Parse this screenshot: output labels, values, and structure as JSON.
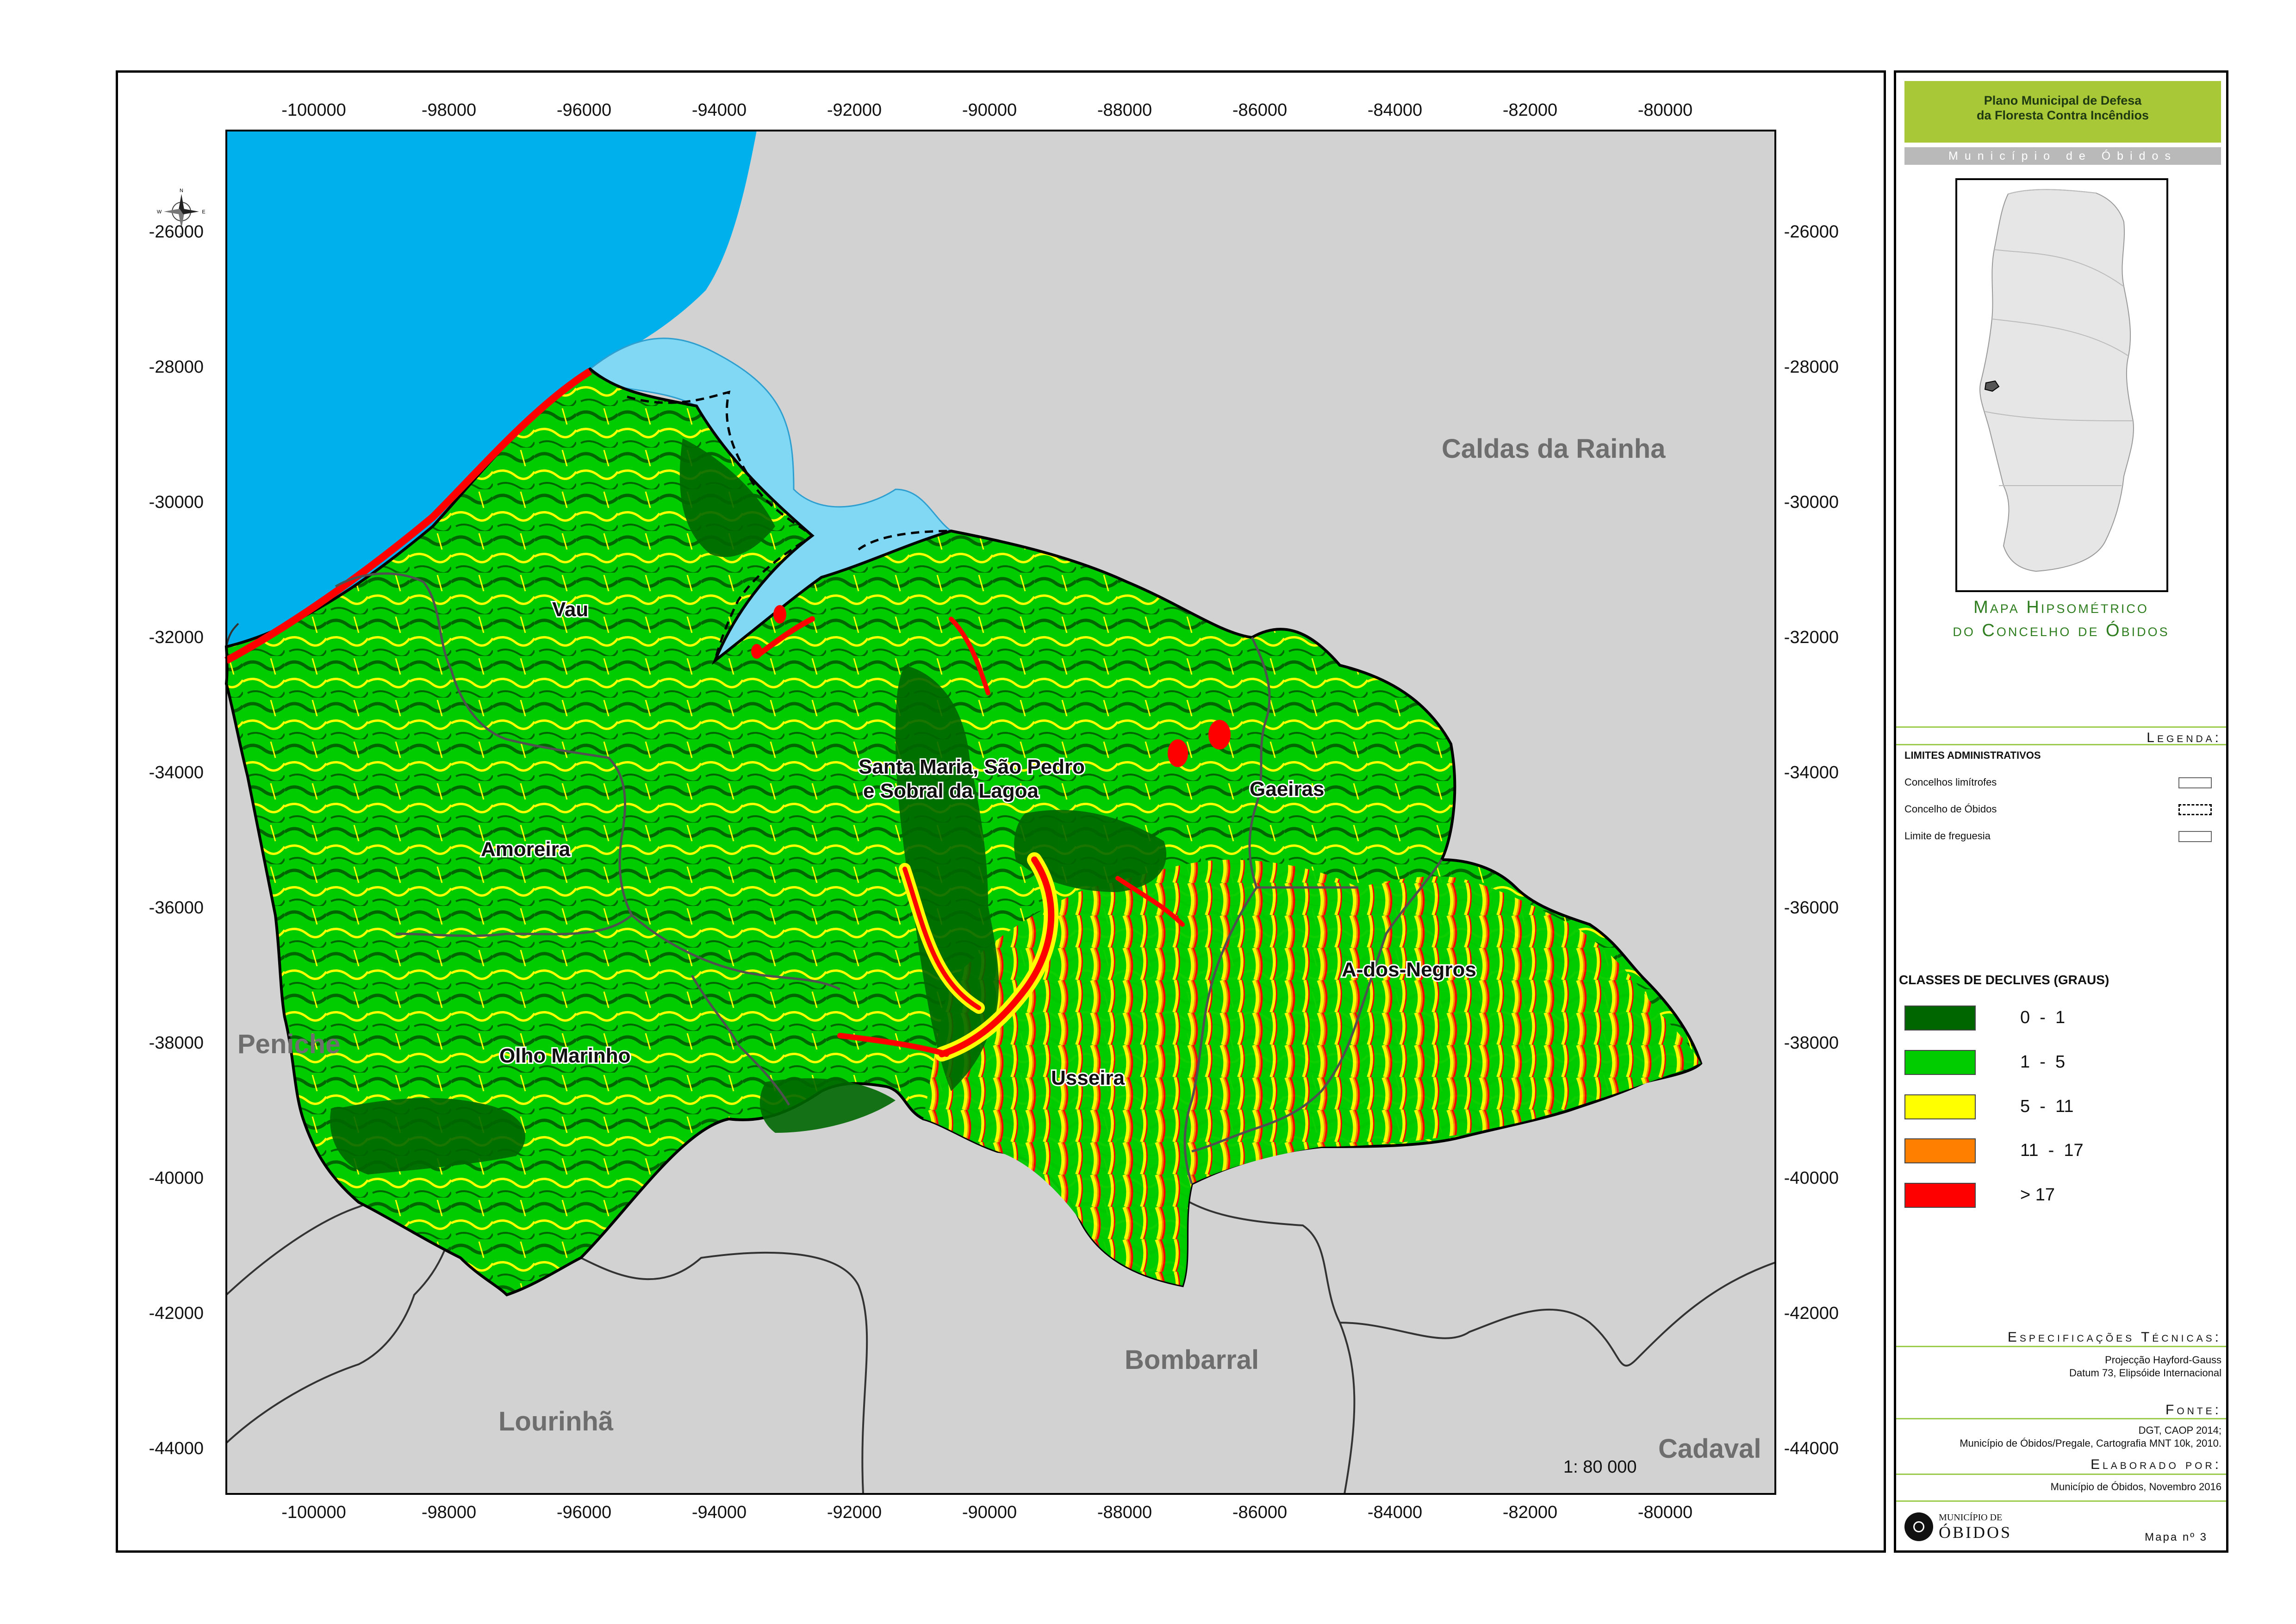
{
  "map": {
    "coords_x": [
      "-100000",
      "-98000",
      "-96000",
      "-94000",
      "-92000",
      "-90000",
      "-88000",
      "-86000",
      "-84000",
      "-82000",
      "-80000"
    ],
    "coords_y": [
      "-26000",
      "-28000",
      "-30000",
      "-32000",
      "-34000",
      "-36000",
      "-38000",
      "-40000",
      "-42000",
      "-44000"
    ],
    "neighbours": [
      "Caldas da Rainha",
      "Peniche",
      "Bombarral",
      "Lourinhã",
      "Cadaval"
    ],
    "parishes": [
      "Vau",
      "Amoreira",
      "Santa Maria, São Pedro",
      "e Sobral da Lagoa",
      "Gaeiras",
      "A-dos-Negros",
      "Usseira",
      "Olho Marinho"
    ],
    "scale": "1: 80 000",
    "compass": [
      "N",
      "S",
      "W",
      "E"
    ],
    "colors": {
      "sea": "#00b0ec",
      "lagoon": "#80d8f4",
      "neighbour_land": "#d2d2d2",
      "slope_0_1": "#006600",
      "slope_1_5": "#00cc00",
      "slope_5_11": "#ffff00",
      "slope_11_17": "#ff8000",
      "slope_gt17": "#ff0000"
    }
  },
  "panel": {
    "title_line1": "Plano Municipal de Defesa",
    "title_line2": "da Floresta Contra Incêndios",
    "municipality": "Município de Óbidos",
    "map_title_line1": "Mapa Hipsométrico",
    "map_title_line2": "do Concelho de Óbidos",
    "legend_heading": "Legenda:",
    "limits_heading": "LIMITES ADMINISTRATIVOS",
    "limits": [
      "Concelhos limítrofes",
      "Concelho de Óbidos",
      "Limite de freguesia"
    ],
    "classes_heading": "CLASSES DE DECLIVES (GRAUS)",
    "classes": [
      {
        "label": "0  -  1",
        "color": "#006600"
      },
      {
        "label": "1  -  5",
        "color": "#00cc00"
      },
      {
        "label": "5  -  11",
        "color": "#ffff00"
      },
      {
        "label": "11  -  17",
        "color": "#ff8000"
      },
      {
        "label": "> 17",
        "color": "#ff0000"
      }
    ],
    "spec_heading": "Especificações Técnicas:",
    "spec_line1": "Projecção Hayford-Gauss",
    "spec_line2": "Datum 73, Elipsóide Internacional",
    "source_heading": "Fonte:",
    "source_line1": "DGT, CAOP 2014;",
    "source_line2": "Município de Óbidos/Pregale, Cartografia MNT 10k, 2010.",
    "author_heading": "Elaborado por:",
    "author_line1": "Município de Óbidos, Novembro 2016",
    "logo_small": "MUNICÍPIO DE",
    "logo_big": "ÓBIDOS",
    "map_number": "Mapa nº 3"
  }
}
